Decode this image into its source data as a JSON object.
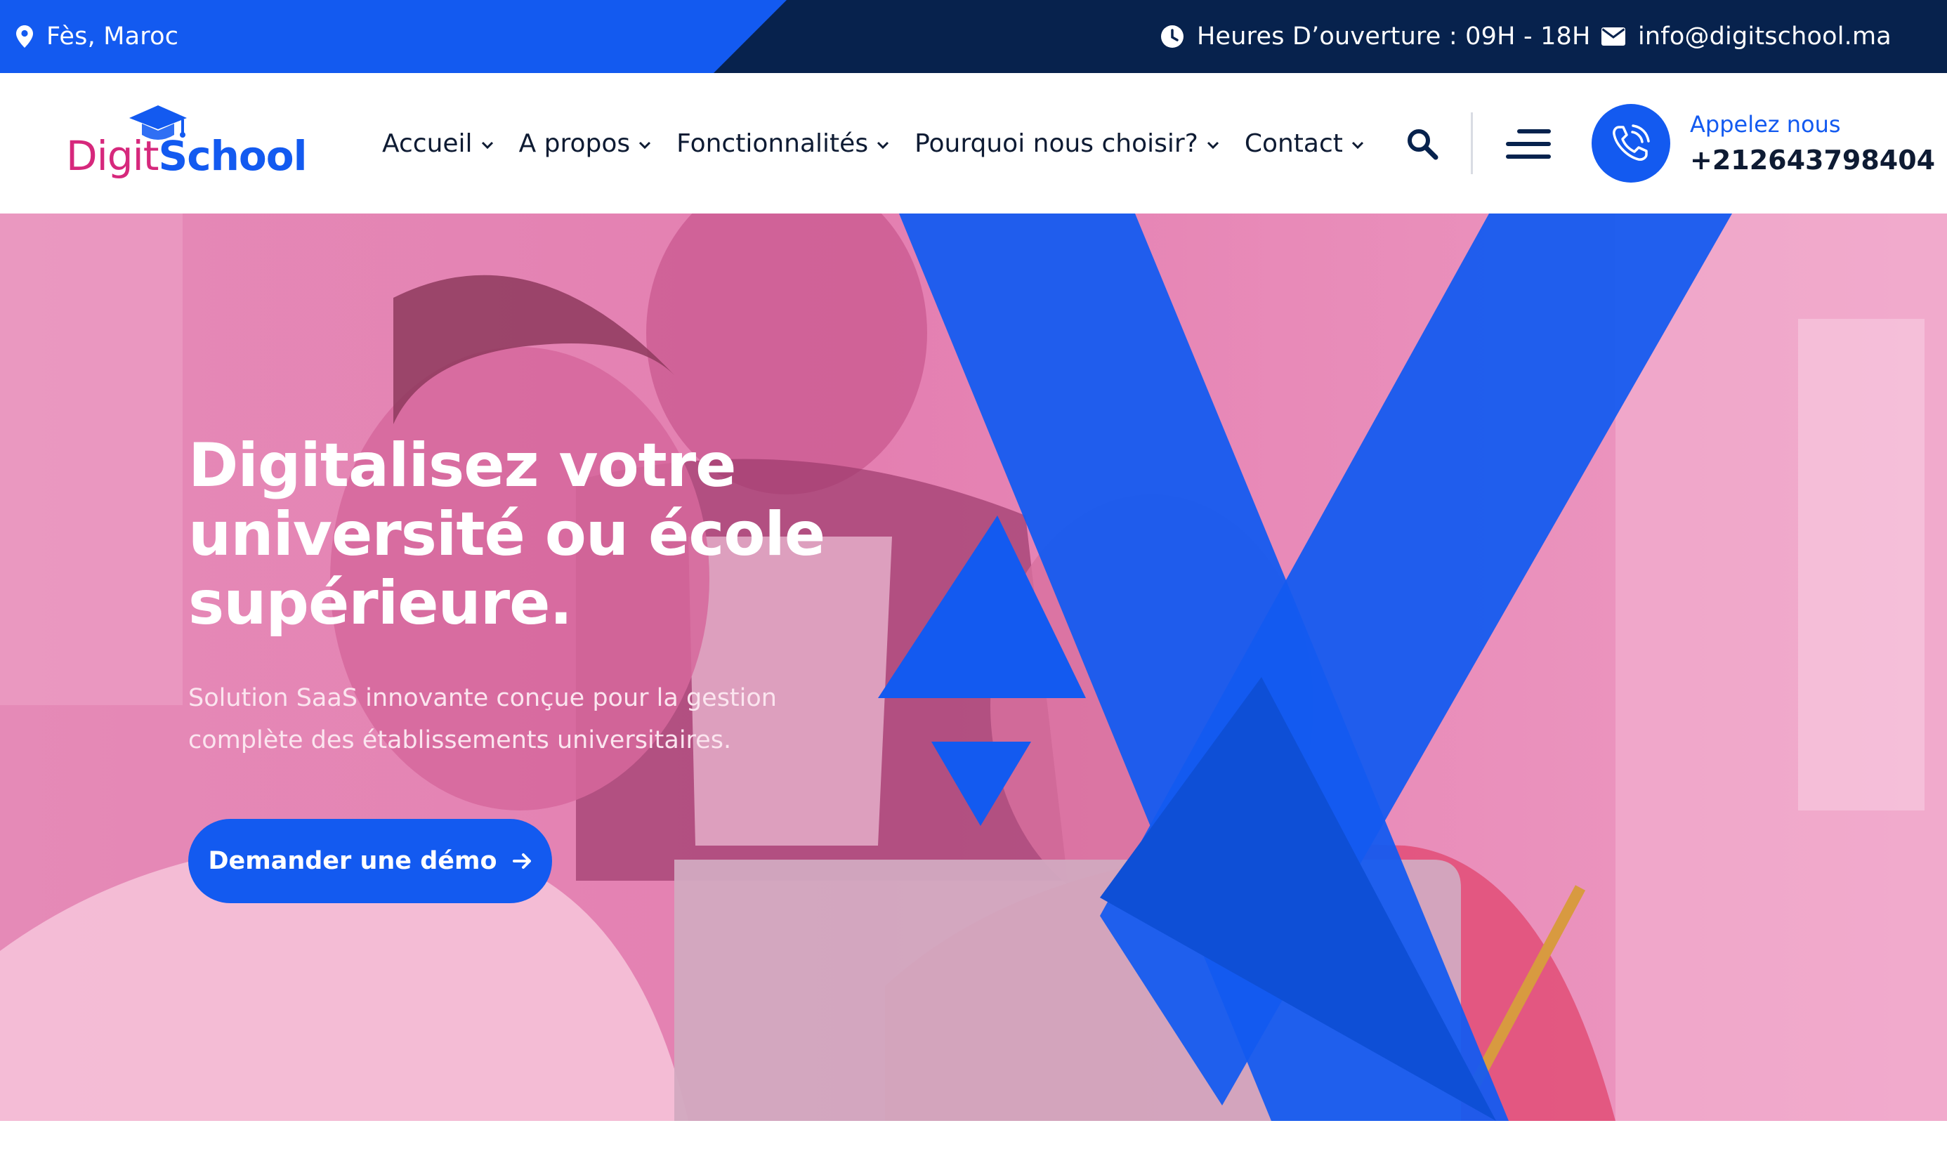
{
  "topbar": {
    "location": "Fès, Maroc",
    "hours": "Heures D’ouverture : 09H - 18H",
    "email": "info@digitschool.ma",
    "icons": [
      "map-pin-icon",
      "clock-icon",
      "envelope-icon"
    ]
  },
  "logo": {
    "part1": "Digit",
    "part2": "School"
  },
  "nav": {
    "items": [
      {
        "label": "Accueil"
      },
      {
        "label": "A propos"
      },
      {
        "label": "Fonctionnalités"
      },
      {
        "label": "Pourquoi nous choisir?"
      },
      {
        "label": "Contact"
      }
    ]
  },
  "header": {
    "call_label": "Appelez nous",
    "phone": "+212643798404"
  },
  "hero": {
    "title_line1": "Digitalisez votre",
    "title_line2": "université ou école",
    "title_line3": "supérieure.",
    "subtitle_line1": "Solution SaaS innovante conçue pour la gestion",
    "subtitle_line2": "complète des établissements universitaires.",
    "cta_label": "Demander une démo"
  },
  "colors": {
    "primary_blue": "#135af0",
    "navy": "#07224d",
    "hero_pink": "#e98bb8",
    "logo_magenta": "#d6287c"
  }
}
